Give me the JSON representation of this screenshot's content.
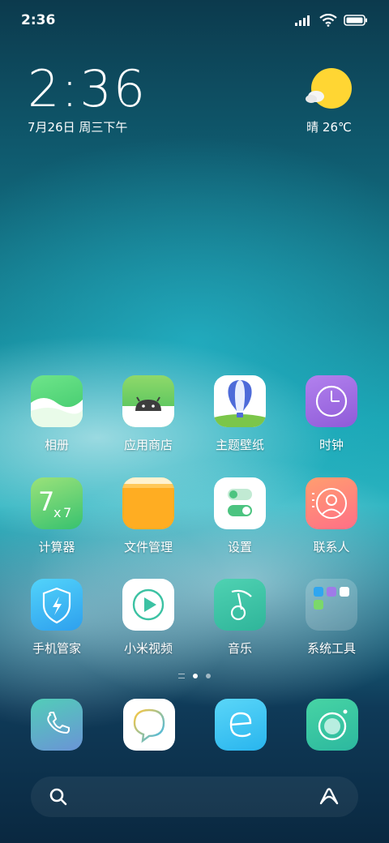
{
  "status_bar": {
    "time": "2:36"
  },
  "clock_widget": {
    "time": "2:36",
    "date": "7月26日 周三下午"
  },
  "weather_widget": {
    "text": "晴 26℃"
  },
  "apps": {
    "gallery": "相册",
    "app_store": "应用商店",
    "themes": "主题壁纸",
    "clock": "时钟",
    "calculator": "计算器",
    "file_manager": "文件管理",
    "settings": "设置",
    "contacts": "联系人",
    "security": "手机管家",
    "mi_video": "小米视频",
    "music": "音乐",
    "system_tools": "系统工具"
  },
  "page_indicator": {
    "pages": 2,
    "current": 1
  },
  "dock": [
    "phone",
    "messages",
    "browser",
    "camera"
  ],
  "colors": {
    "gallery_bg": "#4fd46a",
    "app_store_bg": "#5cc860",
    "clock_bg": "#a06be0",
    "calculator_bg": "#5dcb72",
    "file_manager_bg": "#ffad22",
    "contacts_bg": "#ff7b76",
    "security_bg": "#38b8f2",
    "music_bg": "#3fc6a8",
    "browser_bg": "#2fc7f0",
    "camera_bg": "#2ec2a6"
  }
}
